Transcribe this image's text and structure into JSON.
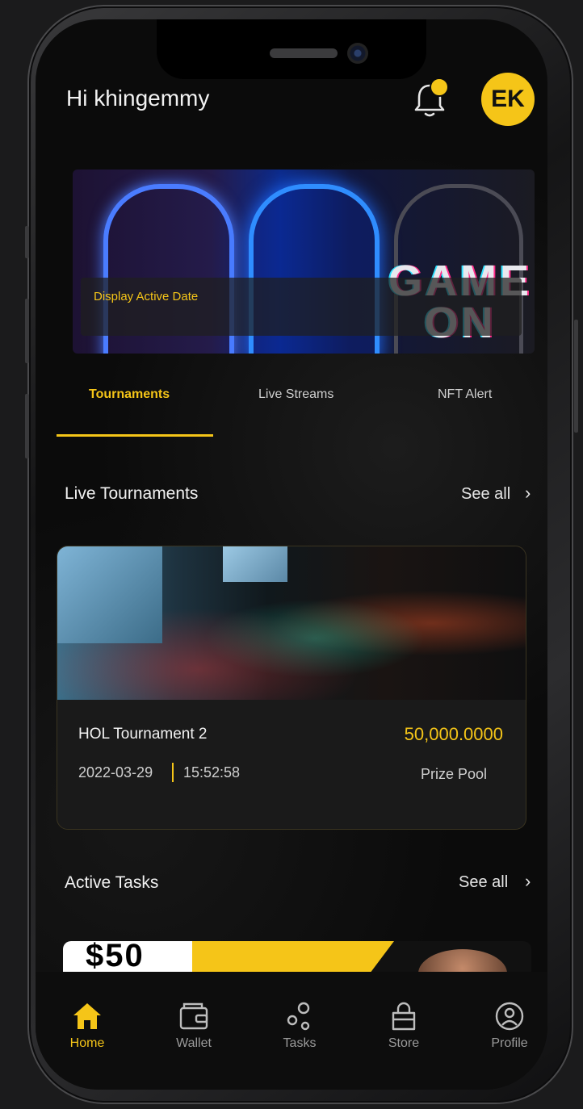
{
  "header": {
    "greeting": "Hi khingemmy",
    "avatar_initials": "EK"
  },
  "banner": {
    "headline": "GAME ON",
    "active_date_label": "Display Active Date"
  },
  "tabs": [
    {
      "label": "Tournaments",
      "active": true
    },
    {
      "label": "Live Streams",
      "active": false
    },
    {
      "label": "NFT Alert",
      "active": false
    }
  ],
  "live_tournaments": {
    "title": "Live Tournaments",
    "see_all": "See all",
    "card": {
      "name": "HOL Tournament 2",
      "prize": "50,000.0000",
      "prize_label": "Prize Pool",
      "date": "2022-03-29",
      "time": "15:52:58"
    }
  },
  "active_tasks": {
    "title": "Active Tasks",
    "see_all": "See all",
    "promo_text": "$50"
  },
  "nav": {
    "items": [
      {
        "label": "Home",
        "icon": "home-icon",
        "active": true
      },
      {
        "label": "Wallet",
        "icon": "wallet-icon",
        "active": false
      },
      {
        "label": "Tasks",
        "icon": "tasks-icon",
        "active": false
      },
      {
        "label": "Store",
        "icon": "store-icon",
        "active": false
      },
      {
        "label": "Profile",
        "icon": "profile-icon",
        "active": false
      }
    ]
  },
  "colors": {
    "accent": "#f5c518",
    "background": "#0b0b0b",
    "card": "#1a1a1a"
  }
}
